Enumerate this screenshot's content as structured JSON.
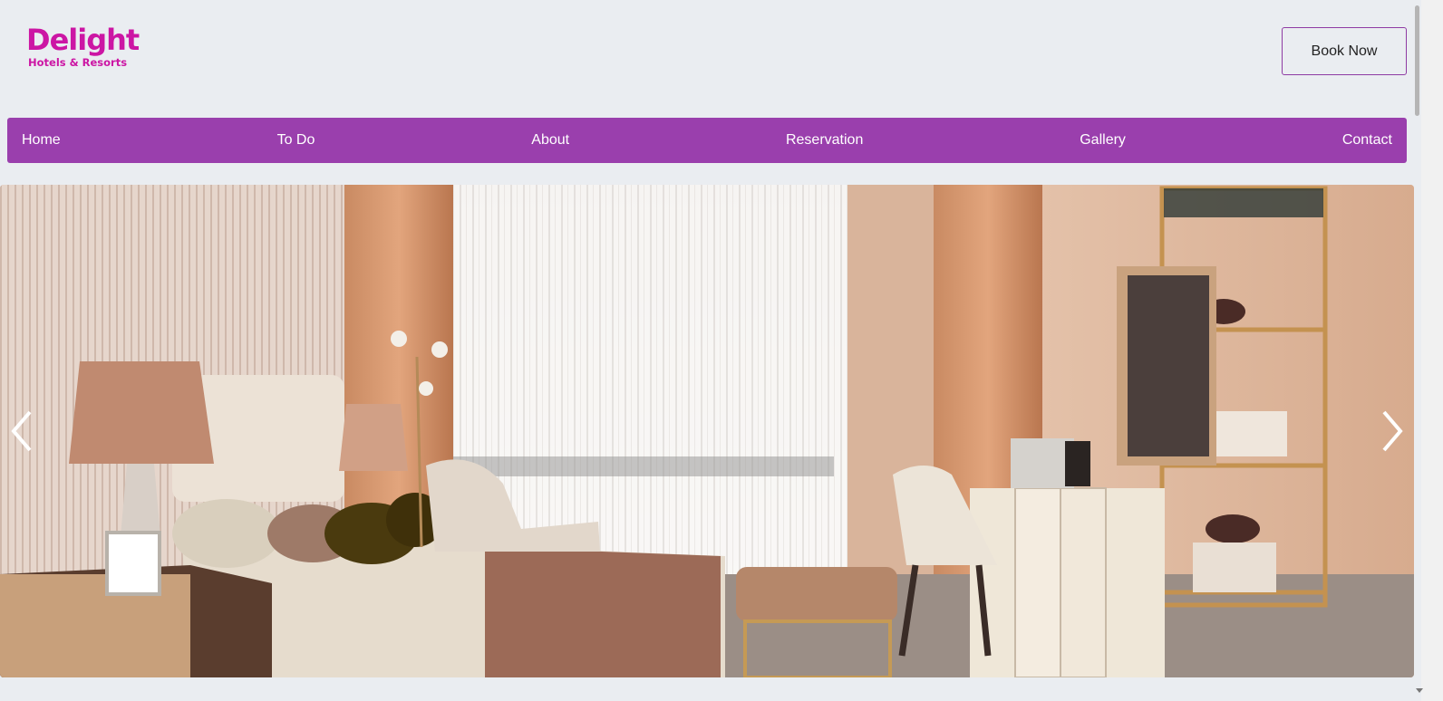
{
  "brand": {
    "name": "Delight",
    "tagline": "Hotels & Resorts",
    "color": "#cc16a4"
  },
  "header": {
    "book_label": "Book Now"
  },
  "nav": {
    "color": "#9a3fad",
    "items": [
      {
        "label": "Home"
      },
      {
        "label": "To Do"
      },
      {
        "label": "About"
      },
      {
        "label": "Reservation"
      },
      {
        "label": "Gallery"
      },
      {
        "label": "Contact"
      }
    ]
  },
  "carousel": {
    "prev_icon": "chevron-left-icon",
    "next_icon": "chevron-right-icon"
  }
}
